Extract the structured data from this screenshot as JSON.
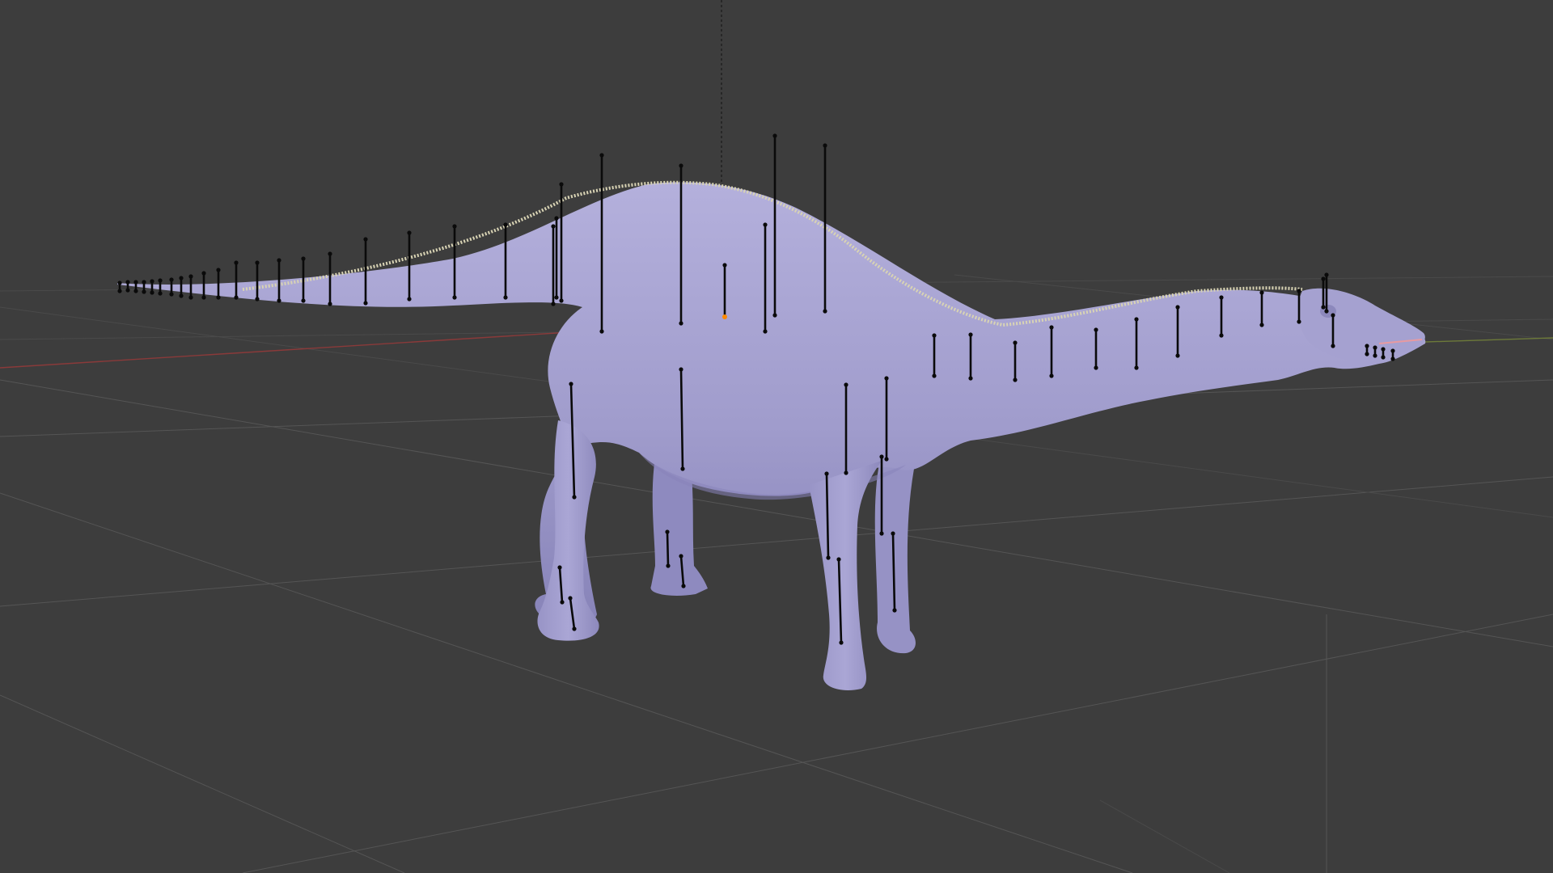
{
  "viewport": {
    "mode": "3d-viewport",
    "background_color": "#3d3d3d",
    "grid_color": "#555555",
    "x_axis_color": "#8a3a3a",
    "y_axis_color": "#6d7a3a",
    "show_grid": true,
    "show_axes": true
  },
  "model": {
    "type": "sauropod-dinosaur-mesh",
    "mesh_color": "#a09ccc",
    "mesh_shade_color": "#7f7bb0",
    "spine_spike_color": "#d8d3b4",
    "armature_visible": true,
    "armature_display": "stick",
    "armature_color": "#0a0a0a"
  },
  "origin": {
    "marker_color": "#ff8a00",
    "parent_line": "dashed"
  }
}
